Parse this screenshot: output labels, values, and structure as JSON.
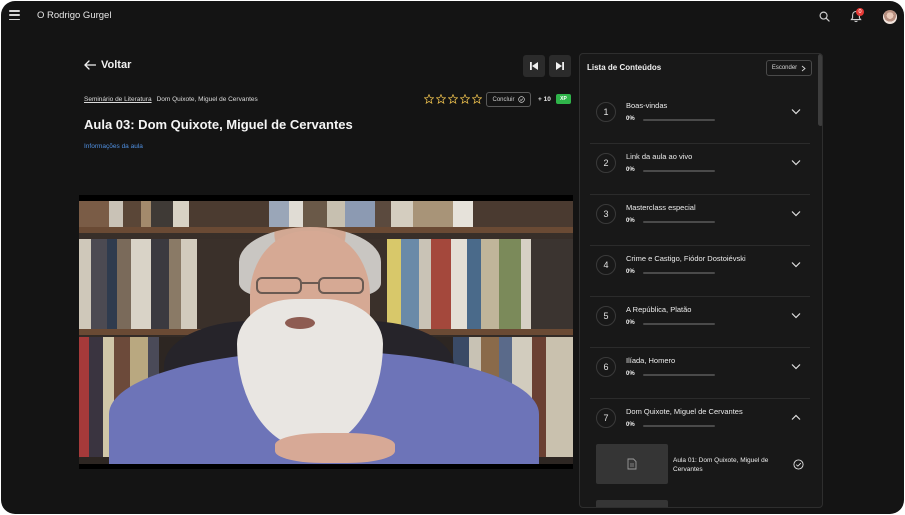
{
  "header": {
    "brand": "O Rodrigo Gurgel",
    "notification_count": "0"
  },
  "nav": {
    "back_label": "Voltar"
  },
  "breadcrumb": {
    "course": "Seminário de Literatura",
    "module": "Dom Quixote, Miguel de Cervantes"
  },
  "lesson": {
    "title": "Aula 03: Dom Quixote, Miguel de Cervantes",
    "info_link": "Informações da aula",
    "rating_stars": 5,
    "rating_value": 0,
    "concluir_label": "Concluir",
    "points": "+ 10",
    "points_badge": "XP"
  },
  "sidebar": {
    "title": "Lista de Conteúdos",
    "hide_label": "Esconder",
    "modules": [
      {
        "number": "1",
        "title": "Boas-vindas",
        "progress": "0%"
      },
      {
        "number": "2",
        "title": "Link da aula ao vivo",
        "progress": "0%"
      },
      {
        "number": "3",
        "title": "Masterclass especial",
        "progress": "0%"
      },
      {
        "number": "4",
        "title": "Crime e Castigo, Fiódor Dostoiévski",
        "progress": "0%"
      },
      {
        "number": "5",
        "title": "A República, Platão",
        "progress": "0%"
      },
      {
        "number": "6",
        "title": "Ilíada, Homero",
        "progress": "0%"
      },
      {
        "number": "7",
        "title": "Dom Quixote, Miguel de Cervantes",
        "progress": "0%",
        "expanded": true
      }
    ],
    "expanded_lessons": [
      {
        "title": "Aula 01: Dom Quixote, Miguel de Cervantes"
      }
    ]
  },
  "colors": {
    "background": "#141414",
    "accent_green": "#2fb44a",
    "link_blue": "#4f8fe0",
    "star_gold": "#e0b64a"
  }
}
